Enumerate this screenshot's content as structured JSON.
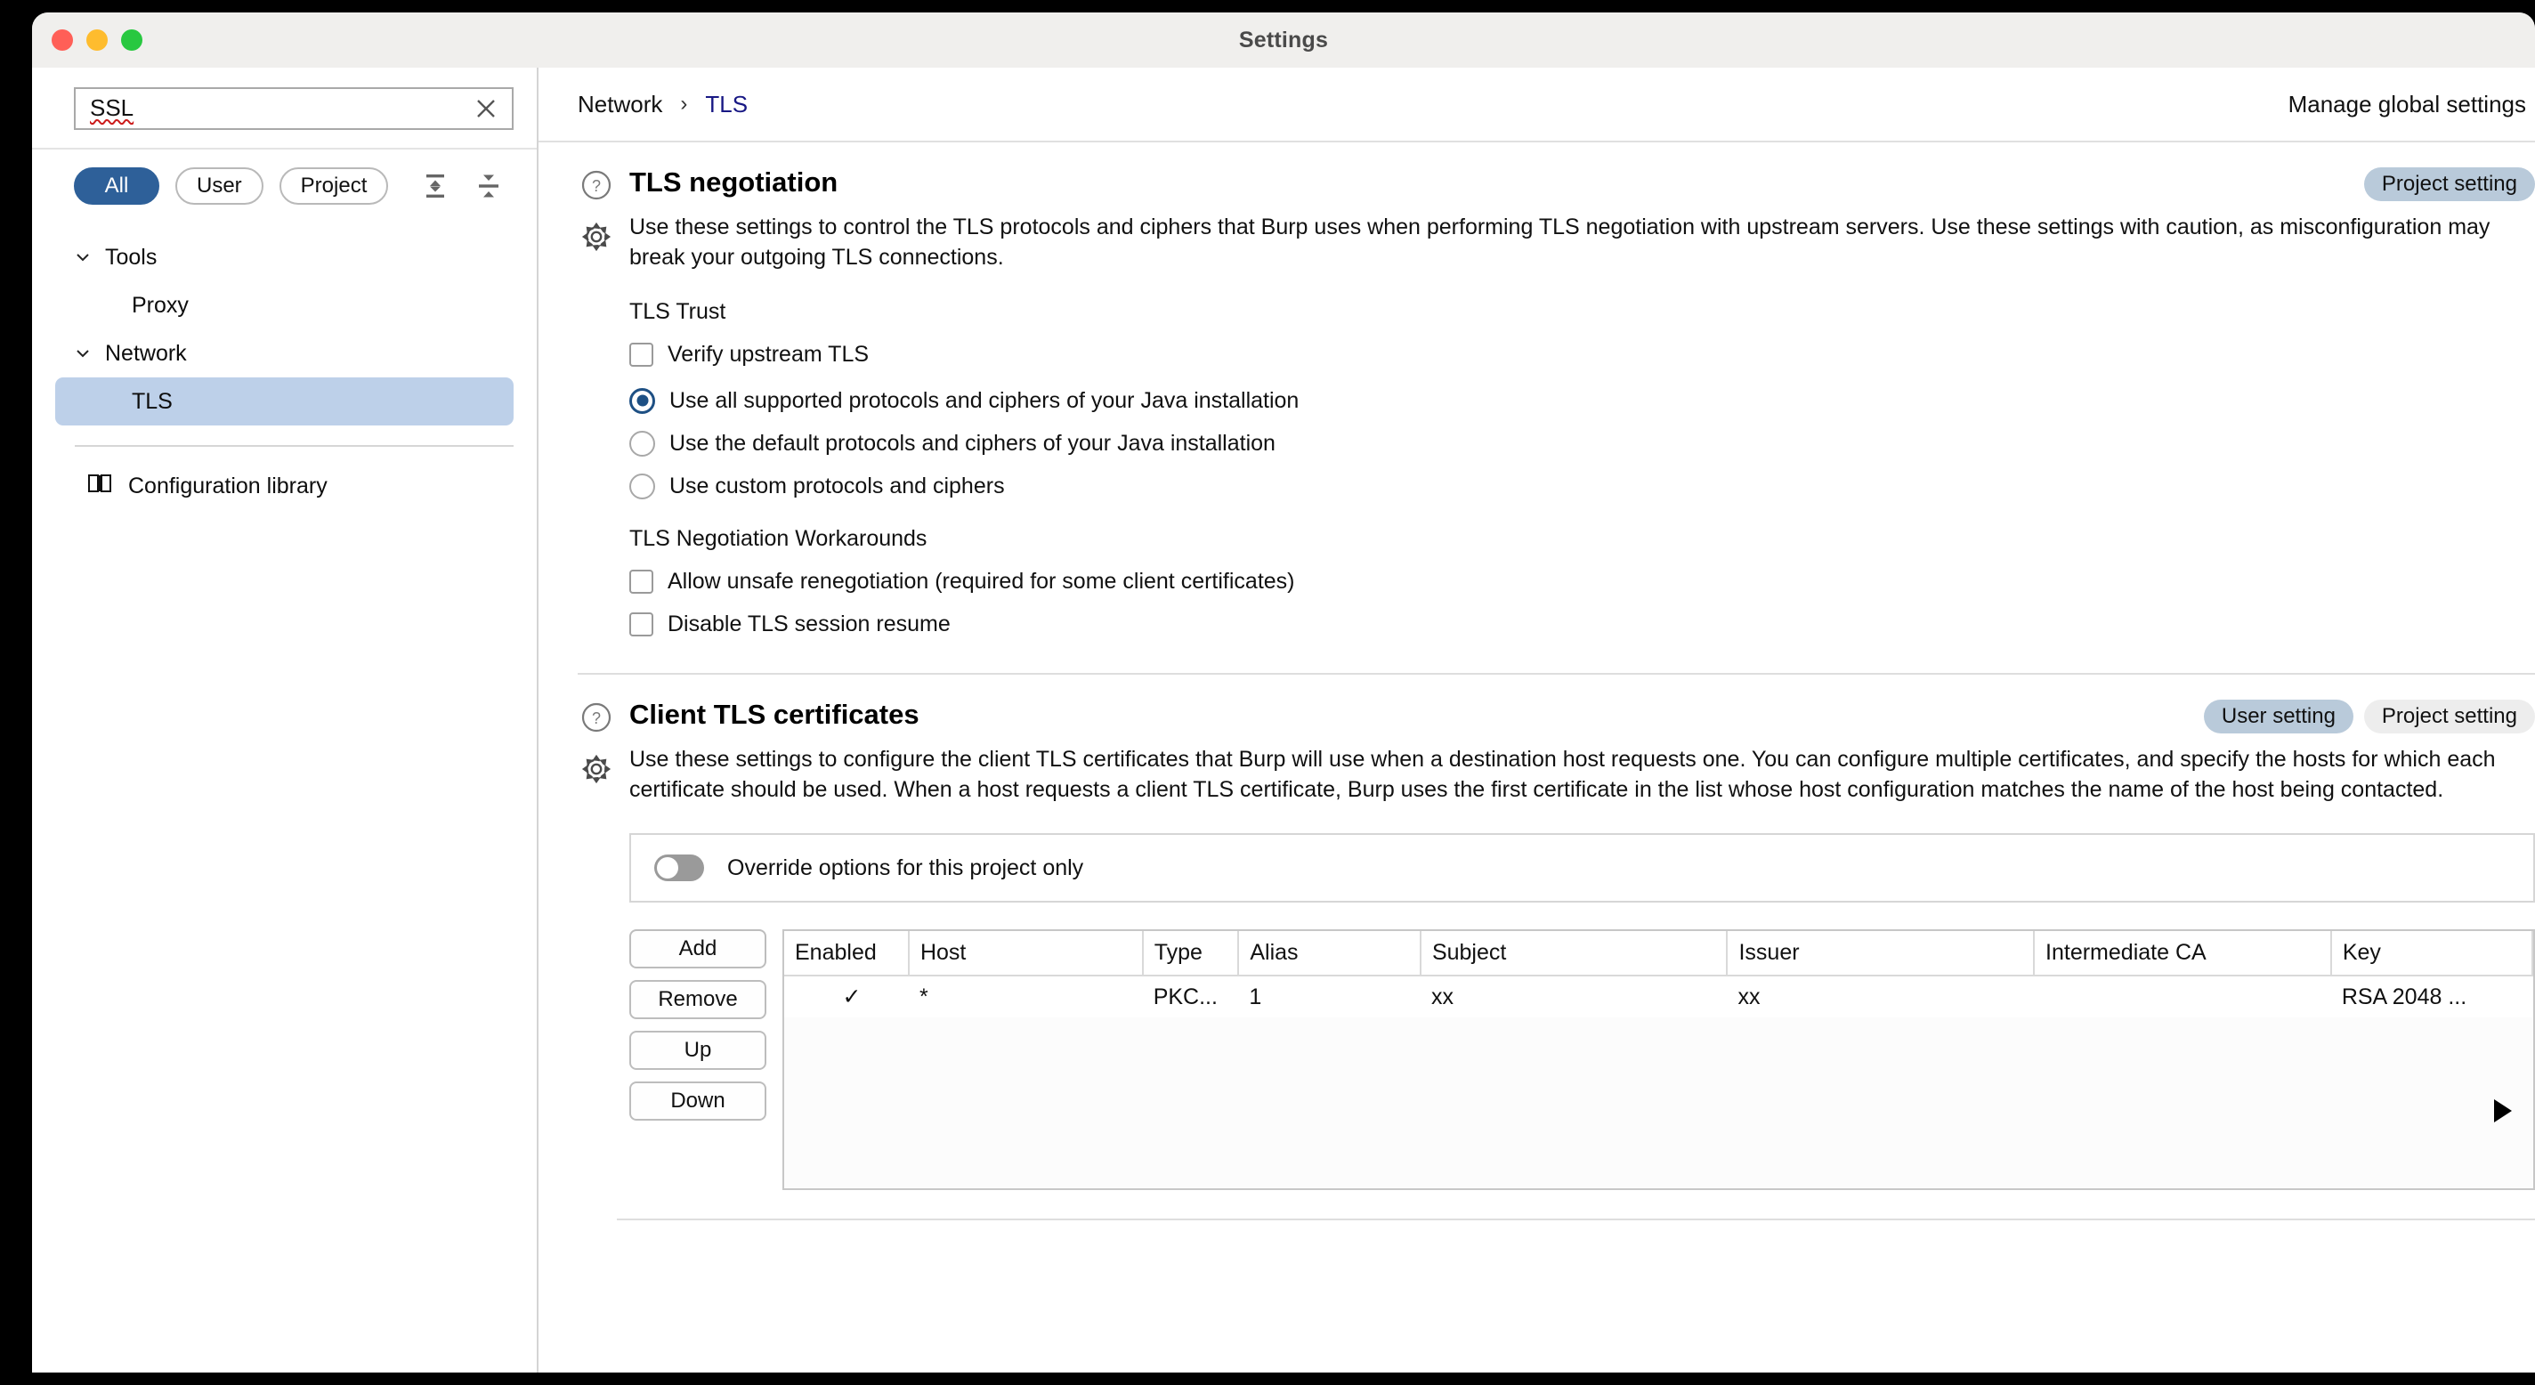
{
  "window": {
    "title": "Settings",
    "traffic_lights": [
      "close",
      "minimize",
      "maximize"
    ]
  },
  "sidebar": {
    "search": {
      "value": "SSL",
      "placeholder": "",
      "clear_icon": "close-icon"
    },
    "filters": [
      {
        "label": "All",
        "active": true
      },
      {
        "label": "User",
        "active": false
      },
      {
        "label": "Project",
        "active": false
      }
    ],
    "tools": [
      {
        "icon": "collapse-all-icon"
      },
      {
        "icon": "expand-all-icon"
      }
    ],
    "tree": [
      {
        "label": "Tools",
        "level": 0,
        "expanded": true,
        "selected": false
      },
      {
        "label": "Proxy",
        "level": 1,
        "expanded": null,
        "selected": false
      },
      {
        "label": "Network",
        "level": 0,
        "expanded": true,
        "selected": false
      },
      {
        "label": "TLS",
        "level": 1,
        "expanded": null,
        "selected": true
      }
    ],
    "library": {
      "label": "Configuration library",
      "icon": "book-icon"
    }
  },
  "header": {
    "breadcrumb": [
      {
        "label": "Network",
        "active": false
      },
      {
        "label": "TLS",
        "active": true
      }
    ],
    "separator": "›",
    "global_settings_link": "Manage global settings"
  },
  "sections": [
    {
      "title": "TLS negotiation",
      "help_icon": "question-circle-icon",
      "gear_icon": "gear-icon",
      "badges": [
        {
          "label": "Project setting",
          "active": true
        }
      ],
      "description": "Use these settings to control the TLS protocols and ciphers that Burp uses when performing TLS negotiation with upstream servers. Use these settings with caution, as misconfiguration may break your outgoing TLS connections.",
      "trust_heading": "TLS Trust",
      "trust_checkbox": {
        "label": "Verify upstream TLS",
        "checked": false
      },
      "radios": [
        {
          "label": "Use all supported protocols and ciphers of your Java installation",
          "checked": true
        },
        {
          "label": "Use the default protocols and ciphers of your Java installation",
          "checked": false
        },
        {
          "label": "Use custom protocols and ciphers",
          "checked": false
        }
      ],
      "workarounds_heading": "TLS Negotiation Workarounds",
      "workarounds": [
        {
          "label": "Allow unsafe renegotiation (required for some client certificates)",
          "checked": false
        },
        {
          "label": "Disable TLS session resume",
          "checked": false
        }
      ]
    },
    {
      "title": "Client TLS certificates",
      "help_icon": "question-circle-icon",
      "gear_icon": "gear-icon",
      "badges": [
        {
          "label": "User setting",
          "active": true
        },
        {
          "label": "Project setting",
          "active": false
        }
      ],
      "description": "Use these settings to configure the client TLS certificates that Burp will use when a destination host requests one. You can configure multiple certificates, and specify the hosts for which each certificate should be used. When a host requests a client TLS certificate, Burp uses the first certificate in the list whose host configuration matches the name of the host being contacted.",
      "override": {
        "label": "Override options for this project only",
        "enabled": false
      },
      "buttons": [
        "Add",
        "Remove",
        "Up",
        "Down"
      ],
      "table": {
        "columns": [
          "Enabled",
          "Host",
          "Type",
          "Alias",
          "Subject",
          "Issuer",
          "Intermediate CA",
          "Key"
        ],
        "rows": [
          {
            "enabled": "✓",
            "host": "*",
            "type": "PKC...",
            "alias": "1",
            "subject": "xx",
            "issuer": "xx",
            "intermediate_ca": "",
            "key": "RSA 2048 ..."
          }
        ]
      },
      "expand_arrow_icon": "play-triangle-icon"
    }
  ],
  "colors": {
    "accent_blue": "#2e6099",
    "selection_blue": "#bdd0e9",
    "badge_active": "#b9cada",
    "badge_inactive": "#ededed",
    "link_blue": "#181884",
    "traffic_close": "#ff5f57",
    "traffic_min": "#febc2e",
    "traffic_max": "#28c840"
  }
}
